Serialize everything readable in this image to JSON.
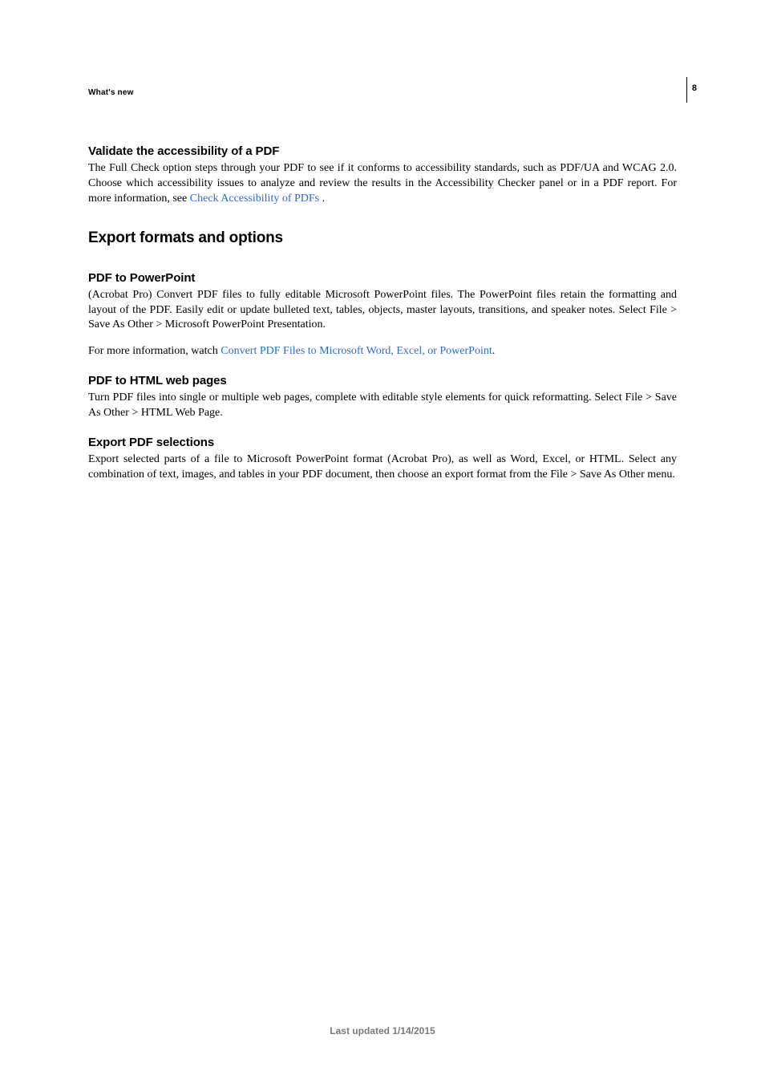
{
  "header": {
    "breadcrumb": "What's new",
    "page_number": "8"
  },
  "sections": {
    "validate": {
      "heading": "Validate the accessibility of a PDF",
      "body_pre": "The Full Check option steps through your PDF to see if it conforms to accessibility standards, such as PDF/UA and WCAG 2.0. Choose which accessibility issues to analyze and review the results in the Accessibility Checker panel or in a PDF report. For more information, see ",
      "link": "Check Accessibility of PDFs",
      "body_post": " ."
    },
    "export_heading": "Export formats and options",
    "ppt": {
      "heading": "PDF to PowerPoint",
      "p1": "(Acrobat Pro) Convert PDF files to fully editable Microsoft PowerPoint files. The PowerPoint files retain the formatting and layout of the PDF. Easily edit or update bulleted text, tables, objects, master layouts, transitions, and speaker notes. Select File > Save As Other > Microsoft PowerPoint Presentation.",
      "p2_pre": "For more information, watch ",
      "p2_link": "Convert PDF Files to Microsoft Word, Excel, or PowerPoint",
      "p2_post": "."
    },
    "html": {
      "heading": "PDF to HTML web pages",
      "p1": "Turn PDF files into single or multiple web pages, complete with editable style elements for quick reformatting. Select File > Save As Other > HTML Web Page."
    },
    "selections": {
      "heading": "Export PDF selections",
      "p1": "Export selected parts of a file to Microsoft PowerPoint format (Acrobat Pro), as well as Word, Excel, or HTML. Select any combination of text, images, and tables in your PDF document, then choose an export format from the File > Save As Other menu."
    }
  },
  "footer": {
    "text": "Last updated 1/14/2015"
  }
}
